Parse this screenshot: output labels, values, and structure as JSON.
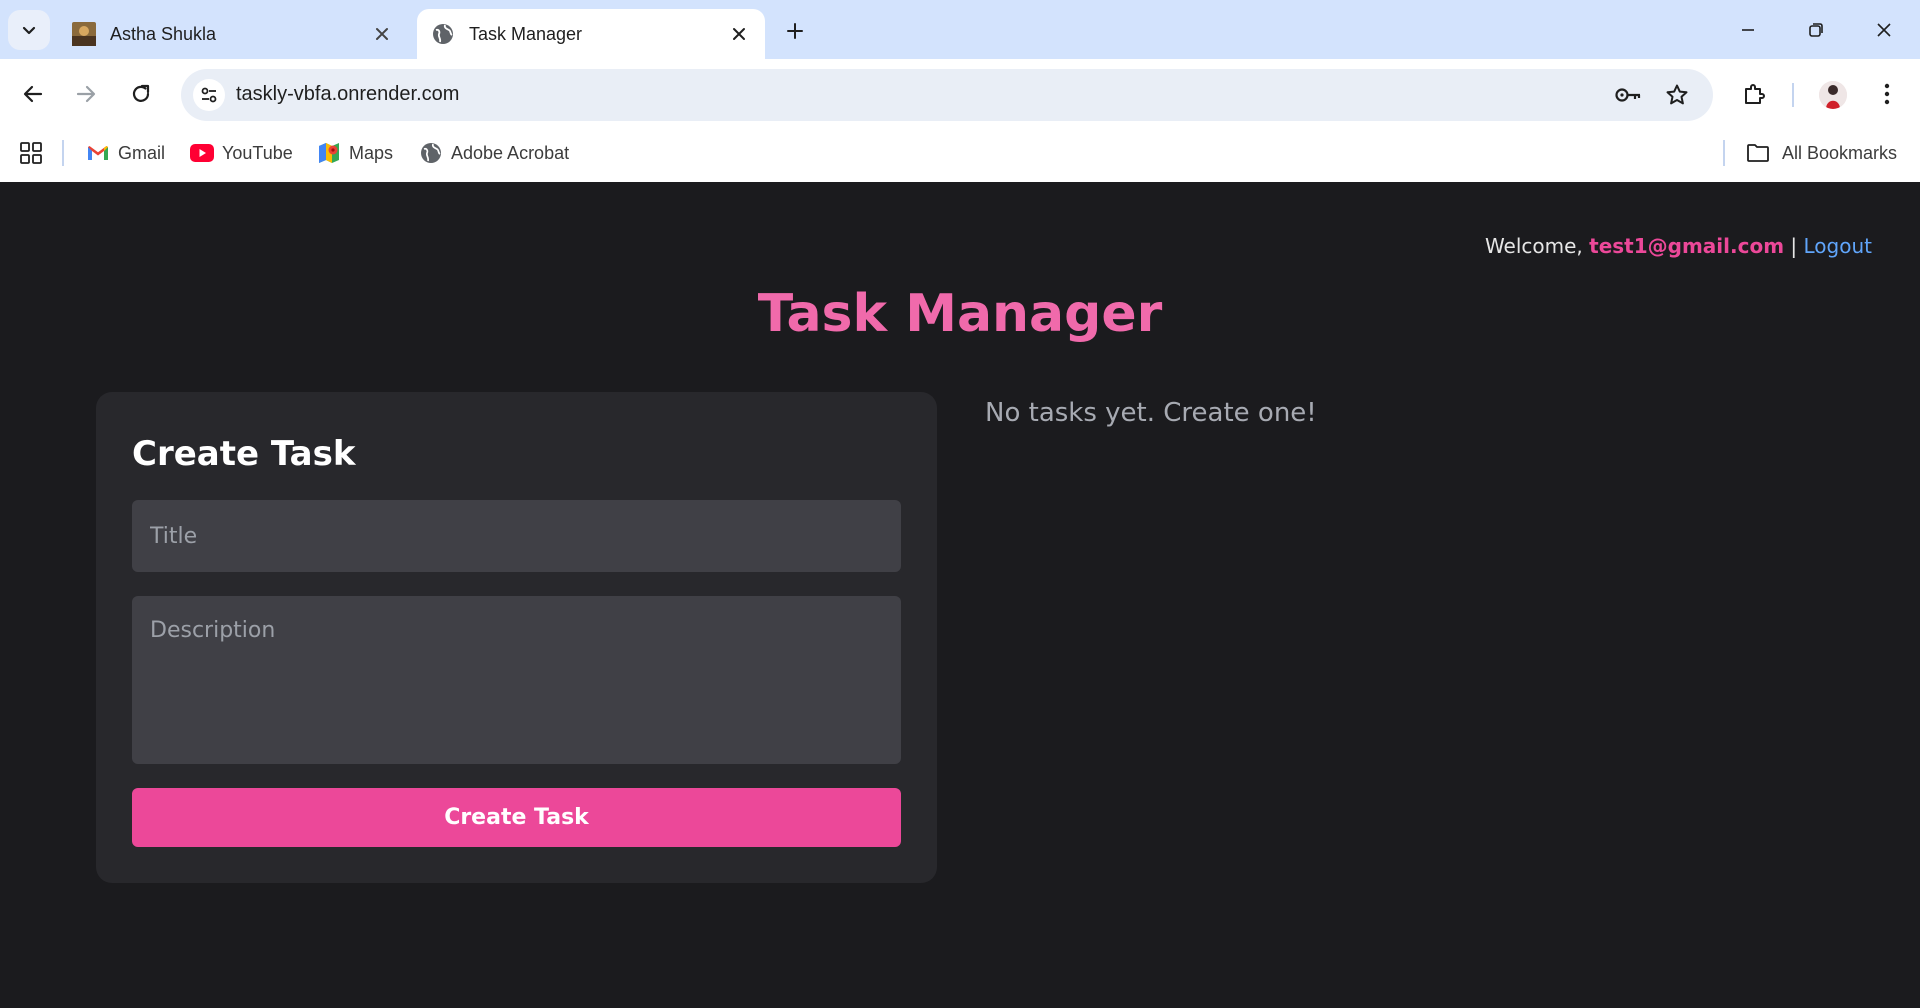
{
  "browser": {
    "tabs": [
      {
        "label": "Astha Shukla",
        "active": false,
        "favicon": "profile-photo-icon"
      },
      {
        "label": "Task Manager",
        "active": true,
        "favicon": "globe-icon"
      }
    ],
    "url": "taskly-vbfa.onrender.com",
    "bookmarks": [
      {
        "label": "Gmail",
        "icon": "gmail-icon"
      },
      {
        "label": "YouTube",
        "icon": "youtube-icon"
      },
      {
        "label": "Maps",
        "icon": "maps-icon"
      },
      {
        "label": "Adobe Acrobat",
        "icon": "globe-icon"
      }
    ],
    "all_bookmarks_label": "All Bookmarks"
  },
  "page": {
    "welcome_prefix": "Welcome,",
    "user_email": "test1@gmail.com",
    "separator": "|",
    "logout_label": "Logout",
    "title": "Task Manager",
    "form": {
      "heading": "Create Task",
      "title_placeholder": "Title",
      "description_placeholder": "Description",
      "submit_label": "Create Task"
    },
    "empty_message": "No tasks yet. Create one!"
  },
  "colors": {
    "accent_pink": "#ec4899",
    "link_blue": "#60a5fa",
    "background": "#1b1b1e",
    "card": "#28282c"
  }
}
